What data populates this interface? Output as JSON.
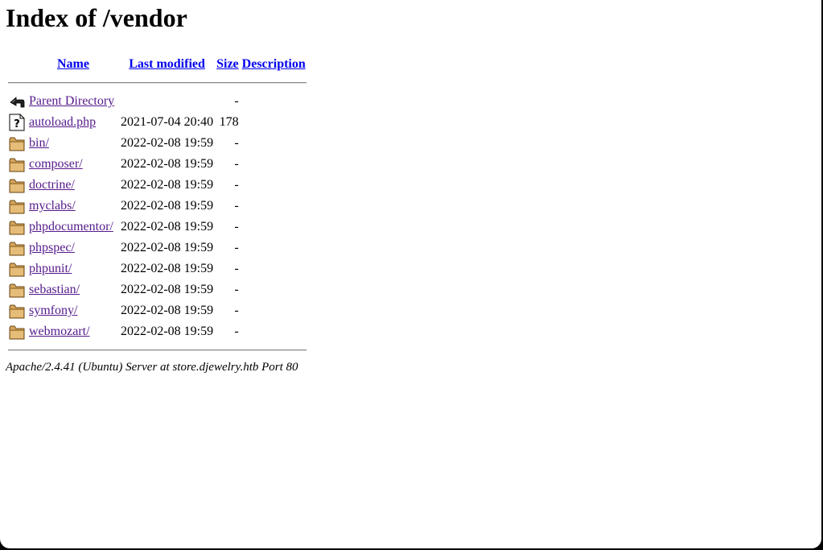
{
  "page": {
    "title": "Index of /vendor"
  },
  "headers": {
    "name": "Name",
    "last_modified": "Last modified",
    "size": "Size",
    "description": "Description"
  },
  "rows": [
    {
      "icon": "back-icon",
      "name": "Parent Directory",
      "date": "",
      "size": "-",
      "desc": ""
    },
    {
      "icon": "unknown-file-icon",
      "name": "autoload.php",
      "date": "2021-07-04 20:40",
      "size": "178",
      "desc": ""
    },
    {
      "icon": "folder-icon",
      "name": "bin/",
      "date": "2022-02-08 19:59",
      "size": "-",
      "desc": ""
    },
    {
      "icon": "folder-icon",
      "name": "composer/",
      "date": "2022-02-08 19:59",
      "size": "-",
      "desc": ""
    },
    {
      "icon": "folder-icon",
      "name": "doctrine/",
      "date": "2022-02-08 19:59",
      "size": "-",
      "desc": ""
    },
    {
      "icon": "folder-icon",
      "name": "myclabs/",
      "date": "2022-02-08 19:59",
      "size": "-",
      "desc": ""
    },
    {
      "icon": "folder-icon",
      "name": "phpdocumentor/",
      "date": "2022-02-08 19:59",
      "size": "-",
      "desc": ""
    },
    {
      "icon": "folder-icon",
      "name": "phpspec/",
      "date": "2022-02-08 19:59",
      "size": "-",
      "desc": ""
    },
    {
      "icon": "folder-icon",
      "name": "phpunit/",
      "date": "2022-02-08 19:59",
      "size": "-",
      "desc": ""
    },
    {
      "icon": "folder-icon",
      "name": "sebastian/",
      "date": "2022-02-08 19:59",
      "size": "-",
      "desc": ""
    },
    {
      "icon": "folder-icon",
      "name": "symfony/",
      "date": "2022-02-08 19:59",
      "size": "-",
      "desc": ""
    },
    {
      "icon": "folder-icon",
      "name": "webmozart/",
      "date": "2022-02-08 19:59",
      "size": "-",
      "desc": ""
    }
  ],
  "footer": {
    "address": "Apache/2.4.41 (Ubuntu) Server at store.djewelry.htb Port 80"
  },
  "colors": {
    "link": "#0000ee",
    "visited_link": "#551a8b",
    "folder": "#d4a55b"
  }
}
